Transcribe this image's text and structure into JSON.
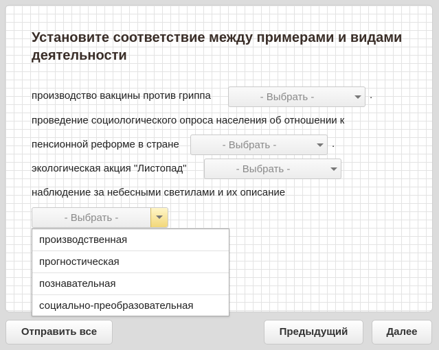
{
  "question": {
    "title": "Установите соответствие между примерами и видами деятельности"
  },
  "items": [
    {
      "text": "производство вакцины против гриппа",
      "suffix": "."
    },
    {
      "text_line1": "проведение социологического опроса населения об отношении к",
      "text_line2": "пенсионной реформе в стране",
      "suffix": "."
    },
    {
      "text": "экологическая акция \"Листопад\""
    },
    {
      "text": "наблюдение за небесными светилами и их описание"
    }
  ],
  "select_placeholder": "- Выбрать -",
  "dropdown": {
    "options": [
      "производственная",
      "прогностическая",
      "познавательная",
      "социально-преобразовательная"
    ]
  },
  "footer": {
    "submit_all": "Отправить все",
    "previous": "Предыдущий",
    "next": "Далее"
  }
}
